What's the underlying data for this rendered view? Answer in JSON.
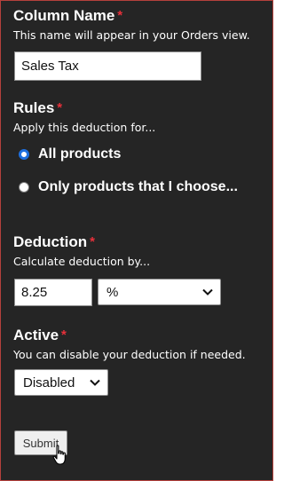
{
  "column_name": {
    "heading": "Column Name",
    "required_mark": "*",
    "hint": "This name will appear in your Orders view.",
    "value": "Sales Tax"
  },
  "rules": {
    "heading": "Rules",
    "required_mark": "*",
    "hint": "Apply this deduction for...",
    "options": [
      {
        "label": "All products",
        "checked": true
      },
      {
        "label": "Only products that I choose...",
        "checked": false
      }
    ]
  },
  "deduction": {
    "heading": "Deduction",
    "required_mark": "*",
    "hint": "Calculate deduction by...",
    "amount": "8.25",
    "unit": "%"
  },
  "active": {
    "heading": "Active",
    "required_mark": "*",
    "hint": "You can disable your deduction if needed.",
    "selected": "Disabled"
  },
  "submit_label": "Submit",
  "colors": {
    "background": "#252525",
    "required": "#e8303a",
    "radio_accent": "#1e6fde",
    "frame_border": "#b5413c"
  },
  "icons": [
    "chevron-down-icon",
    "hand-cursor-icon"
  ]
}
